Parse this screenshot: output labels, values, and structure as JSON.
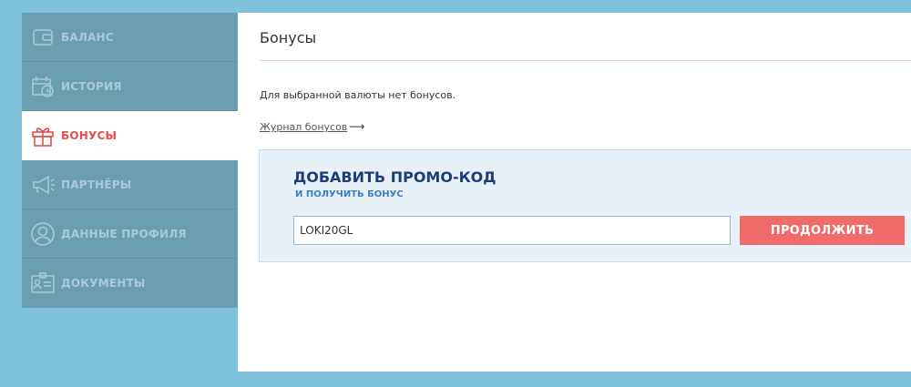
{
  "sidebar": {
    "items": [
      {
        "label": "БАЛАНС",
        "icon": "wallet-icon",
        "active": false
      },
      {
        "label": "ИСТОРИЯ",
        "icon": "calendar-clock-icon",
        "active": false
      },
      {
        "label": "БОНУСЫ",
        "icon": "gift-icon",
        "active": true
      },
      {
        "label": "ПАРТНЁРЫ",
        "icon": "megaphone-icon",
        "active": false
      },
      {
        "label": "ДАННЫЕ ПРОФИЛЯ",
        "icon": "user-profile-icon",
        "active": false
      },
      {
        "label": "ДОКУМЕНТЫ",
        "icon": "id-card-icon",
        "active": false
      }
    ]
  },
  "main": {
    "title": "Бонусы",
    "info_text": "Для выбранной валюты нет бонусов.",
    "journal_link": "Журнал бонусов",
    "promo": {
      "title": "ДОБАВИТЬ ПРОМО-КОД",
      "subtitle": "И ПОЛУЧИТЬ БОНУС",
      "input_value": "LOKI20GL",
      "button_label": "ПРОДОЛЖИТЬ"
    }
  },
  "colors": {
    "page_bg": "#7fc1db",
    "sidebar_bg": "#6a9eb0",
    "active_accent": "#e64d4d",
    "button_bg": "#f26b6b",
    "promo_title": "#1c3e78",
    "promo_subtitle": "#3a7fc5"
  }
}
